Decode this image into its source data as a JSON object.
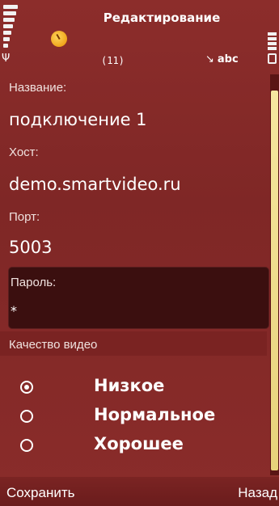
{
  "statusbar": {
    "title": "Редактирование",
    "counter": "(11)",
    "input_mode": "abc",
    "icons": [
      "signal-strength-icon",
      "app-indicator-icon",
      "pen-icon",
      "battery-icon"
    ]
  },
  "form": {
    "name_label": "Название:",
    "name_value": "подключение 1",
    "host_label": "Хост:",
    "host_value": "demo.smartvideo.ru",
    "port_label": "Порт:",
    "port_value": "5003",
    "password_label": "Пароль:",
    "password_value": "*"
  },
  "quality": {
    "label": "Качество видео",
    "options": [
      {
        "label": "Низкое",
        "selected": true
      },
      {
        "label": "Нормальное",
        "selected": false
      },
      {
        "label": "Хорошее",
        "selected": false
      }
    ]
  },
  "softkeys": {
    "left": "Сохранить",
    "right": "Назад"
  },
  "colors": {
    "background": "#8a2c2a",
    "password_field": "#3b0f0f",
    "scroll_thumb": "#f0de8c"
  }
}
